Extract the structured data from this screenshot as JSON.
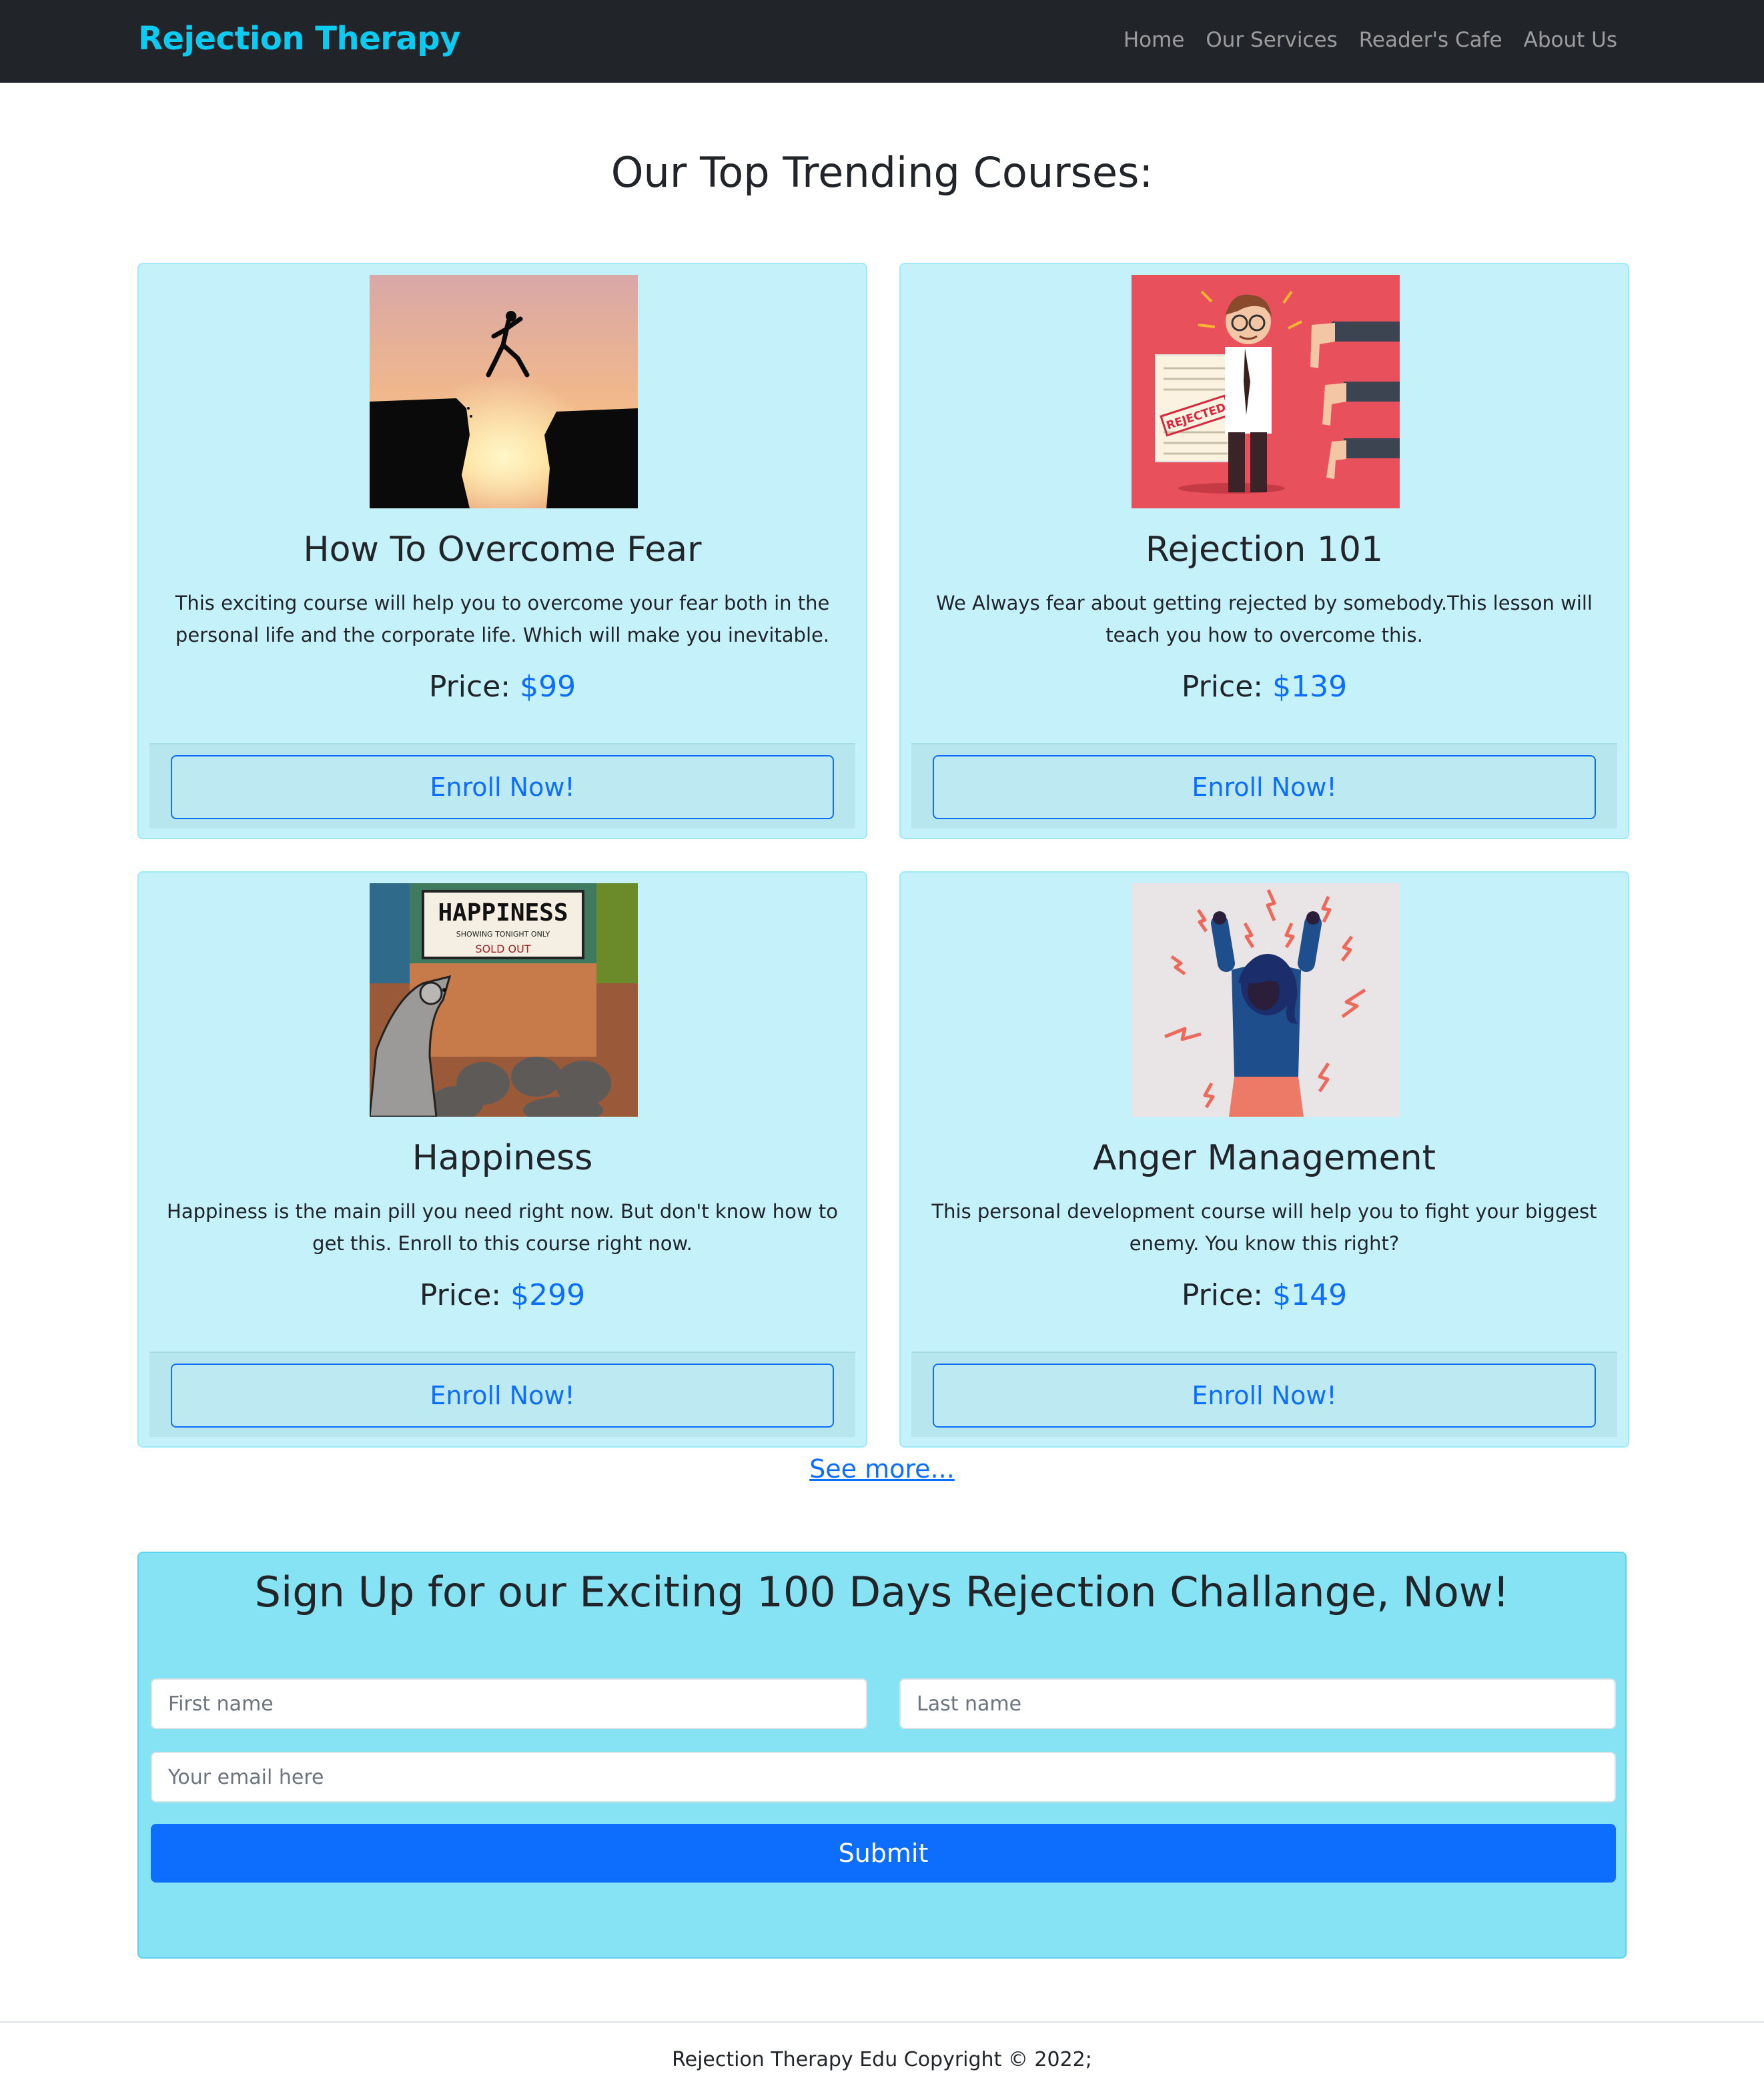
{
  "nav": {
    "brand": "Rejection Therapy",
    "links": [
      "Home",
      "Our Services",
      "Reader's Cafe",
      "About Us"
    ]
  },
  "main": {
    "title": "Our Top Trending Courses:",
    "price_label": "Price:",
    "courses": [
      {
        "title": "How To Overcome Fear",
        "text": "This exciting course will help you to overcome your fear both in the personal life and the corporate life. Which will make you inevitable.",
        "price": "$99",
        "button": "Enroll Now!",
        "image_name": "jump-silhouette-image"
      },
      {
        "title": "Rejection 101",
        "text": "We Always fear about getting rejected by somebody.This lesson will teach you how to overcome this.",
        "price": "$139",
        "button": "Enroll Now!",
        "image_name": "rejected-man-image",
        "image_label": "REJECTED"
      },
      {
        "title": "Happiness",
        "text": "Happiness is the main pill you need right now. But don't know how to get this. Enroll to this course right now.",
        "price": "$299",
        "button": "Enroll Now!",
        "image_name": "happiness-rats-image",
        "image_label": "HAPPINESS",
        "image_sub": "SHOWING TONIGHT ONLY",
        "image_sub2": "SOLD OUT"
      },
      {
        "title": "Anger Management",
        "text": "This personal development course will help you to fight your biggest enemy. You know this right?",
        "price": "$149",
        "button": "Enroll Now!",
        "image_name": "angry-woman-image"
      }
    ],
    "see_more": "See more..."
  },
  "signup": {
    "title": "Sign Up for our Exciting 100 Days Rejection Challange, Now!",
    "first_placeholder": "First name",
    "last_placeholder": "Last name",
    "email_placeholder": "Your email here",
    "submit": "Submit"
  },
  "footer": {
    "text": "Rejection Therapy Edu Copyright © 2022;"
  },
  "colors": {
    "navbar": "#212529",
    "brand": "#0dcaf0",
    "card_bg": "#c4f1fa",
    "signup_bg": "#86e3f4",
    "primary": "#0d6efd"
  }
}
